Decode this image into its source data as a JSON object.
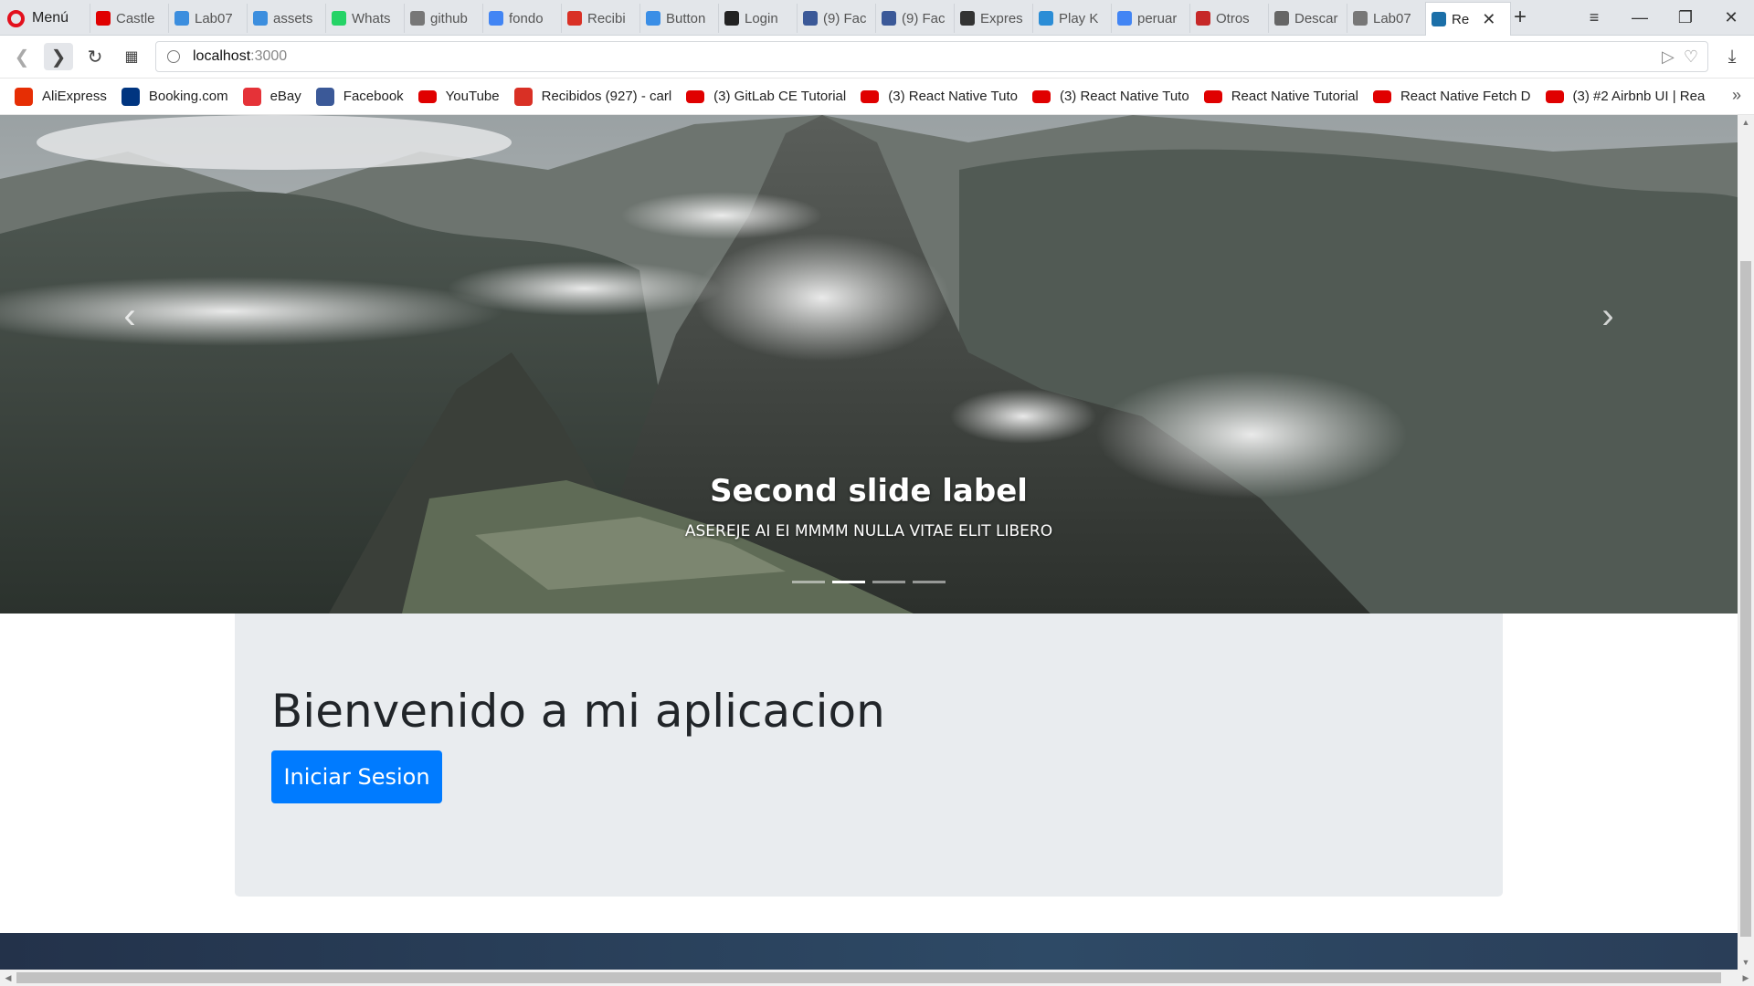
{
  "browser": {
    "menu_label": "Menú",
    "tabs": [
      {
        "label": "Castle",
        "icon": "youtube-icon",
        "color": "#e00000"
      },
      {
        "label": "Lab07",
        "icon": "vue-icon",
        "color": "#3c8ede"
      },
      {
        "label": "assets",
        "icon": "vue-icon",
        "color": "#3c8ede"
      },
      {
        "label": "Whats",
        "icon": "whatsapp-icon",
        "color": "#25d366"
      },
      {
        "label": "github",
        "icon": "document-icon",
        "color": "#777777"
      },
      {
        "label": "fondo",
        "icon": "google-icon",
        "color": "#4285f4"
      },
      {
        "label": "Recibi",
        "icon": "gmail-icon",
        "color": "#d93025"
      },
      {
        "label": "Button",
        "icon": "react-icon",
        "color": "#3a8ee6"
      },
      {
        "label": "Login",
        "icon": "ea-icon",
        "color": "#222222"
      },
      {
        "label": "(9) Fac",
        "icon": "facebook-icon",
        "color": "#3b5998"
      },
      {
        "label": "(9) Fac",
        "icon": "facebook-icon",
        "color": "#3b5998"
      },
      {
        "label": "Expres",
        "icon": "express-icon",
        "color": "#333333"
      },
      {
        "label": "Play K",
        "icon": "playk-icon",
        "color": "#2b8dd6"
      },
      {
        "label": "peruar",
        "icon": "google-icon",
        "color": "#4285f4"
      },
      {
        "label": "Otros",
        "icon": "tag-icon",
        "color": "#c62828"
      },
      {
        "label": "Descar",
        "icon": "download-icon",
        "color": "#666666"
      },
      {
        "label": "Lab07",
        "icon": "document-icon",
        "color": "#777777"
      },
      {
        "label": "Re",
        "icon": "react-icon",
        "color": "#1b6fa8",
        "active": true
      }
    ],
    "url_host": "localhost",
    "url_port": ":3000",
    "bookmarks": [
      {
        "label": "AliExpress",
        "icon": "aliexpress-icon",
        "color": "#e62e04"
      },
      {
        "label": "Booking.com",
        "icon": "booking-icon",
        "color": "#003580"
      },
      {
        "label": "eBay",
        "icon": "ebay-icon",
        "color": "#e53238"
      },
      {
        "label": "Facebook",
        "icon": "facebook-icon",
        "color": "#3b5998"
      },
      {
        "label": "YouTube",
        "icon": "youtube-icon",
        "color": "#e00000"
      },
      {
        "label": "Recibidos (927) - carl",
        "icon": "gmail-icon",
        "color": "#d93025"
      },
      {
        "label": "(3) GitLab CE Tutorial",
        "icon": "youtube-icon",
        "color": "#e00000"
      },
      {
        "label": "(3) React Native Tuto",
        "icon": "youtube-icon",
        "color": "#e00000"
      },
      {
        "label": "(3) React Native Tuto",
        "icon": "youtube-icon",
        "color": "#e00000"
      },
      {
        "label": "React Native Tutorial",
        "icon": "youtube-icon",
        "color": "#e00000"
      },
      {
        "label": "React Native Fetch D",
        "icon": "youtube-icon",
        "color": "#e00000"
      },
      {
        "label": "(3) #2 Airbnb UI | Rea",
        "icon": "youtube-icon",
        "color": "#e00000"
      }
    ]
  },
  "page": {
    "carousel": {
      "caption_title": "Second slide label",
      "caption_text": "ASEREJE AI EI MMMM NULLA VITAE ELIT LIBERO",
      "indicator_count": 4,
      "active_indicator": 2
    },
    "jumbotron": {
      "heading": "Bienvenido a mi aplicacion",
      "button_label": "Iniciar Sesion"
    }
  }
}
